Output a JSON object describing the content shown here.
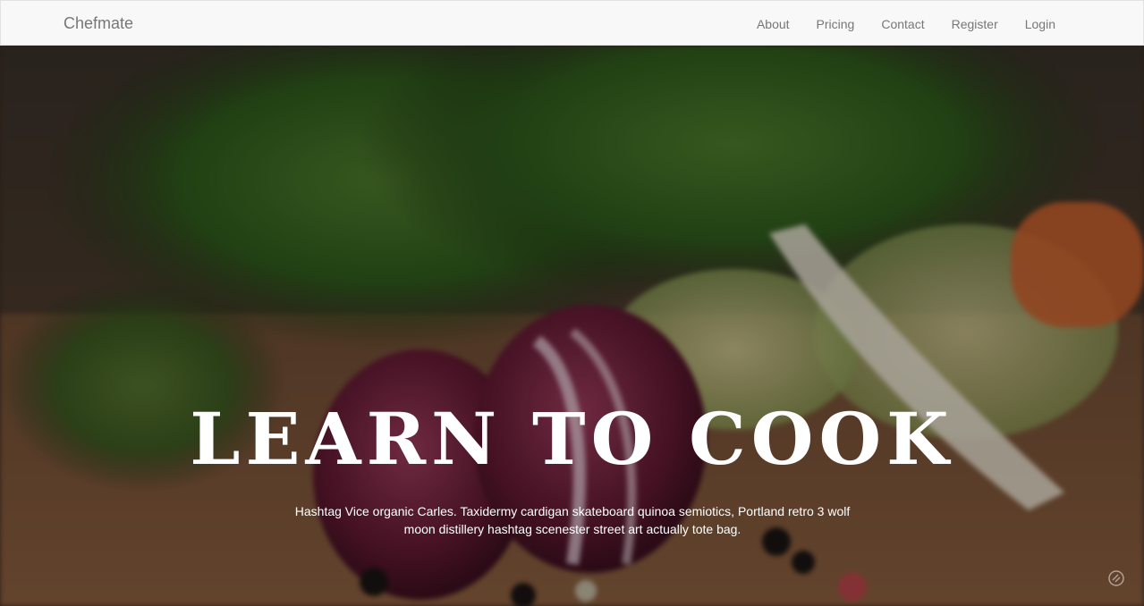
{
  "navbar": {
    "brand": "Chefmate",
    "links": [
      {
        "label": "About"
      },
      {
        "label": "Pricing"
      },
      {
        "label": "Contact"
      },
      {
        "label": "Register"
      },
      {
        "label": "Login"
      }
    ]
  },
  "hero": {
    "title": "Learn to cook",
    "text": "Hashtag Vice organic Carles. Taxidermy cardigan skateboard quinoa semiotics, Portland retro 3 wolf moon distillery hashtag scenester street art actually tote bag.",
    "background_icon": "vegetables-photo"
  },
  "colors": {
    "navbar_bg": "#f8f8f8",
    "nav_text": "#777777",
    "hero_text": "#ffffff"
  }
}
